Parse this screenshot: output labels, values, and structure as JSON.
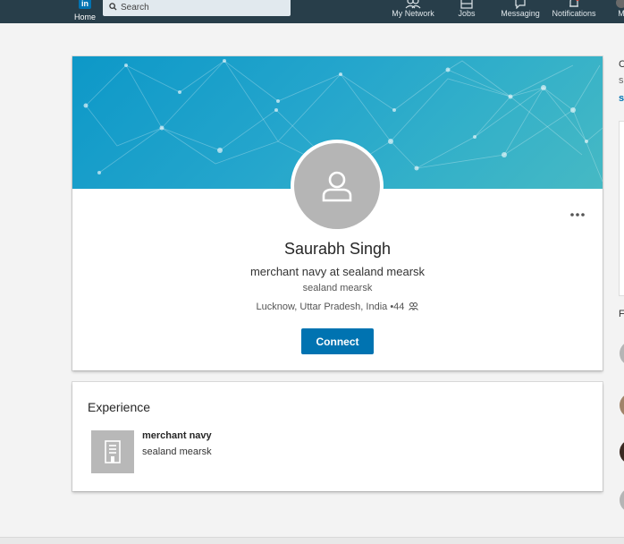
{
  "nav": {
    "home_label": "Home",
    "logo_text": "in",
    "search_placeholder": "Search",
    "items": [
      {
        "label": "My Network",
        "icon": "people-icon"
      },
      {
        "label": "Jobs",
        "icon": "briefcase-icon"
      },
      {
        "label": "Messaging",
        "icon": "chat-icon"
      },
      {
        "label": "Notifications",
        "icon": "bell-icon"
      },
      {
        "label": "M",
        "icon": "me-avatar-icon"
      }
    ],
    "background_color": "#283e4a"
  },
  "profile": {
    "name": "Saurabh Singh",
    "headline": "merchant navy at sealand mearsk",
    "company": "sealand mearsk",
    "location": "Lucknow, Uttar Pradesh, India",
    "connections": "44",
    "connect_label": "Connect",
    "more_icon": "more-horizontal-icon",
    "accent_color": "#0073b1"
  },
  "experience": {
    "title": "Experience",
    "items": [
      {
        "role": "merchant navy",
        "company": "sealand mearsk",
        "logo_icon": "building-icon"
      }
    ]
  },
  "right_rail": {
    "texts": [
      "C",
      "s",
      "s",
      "F"
    ]
  }
}
